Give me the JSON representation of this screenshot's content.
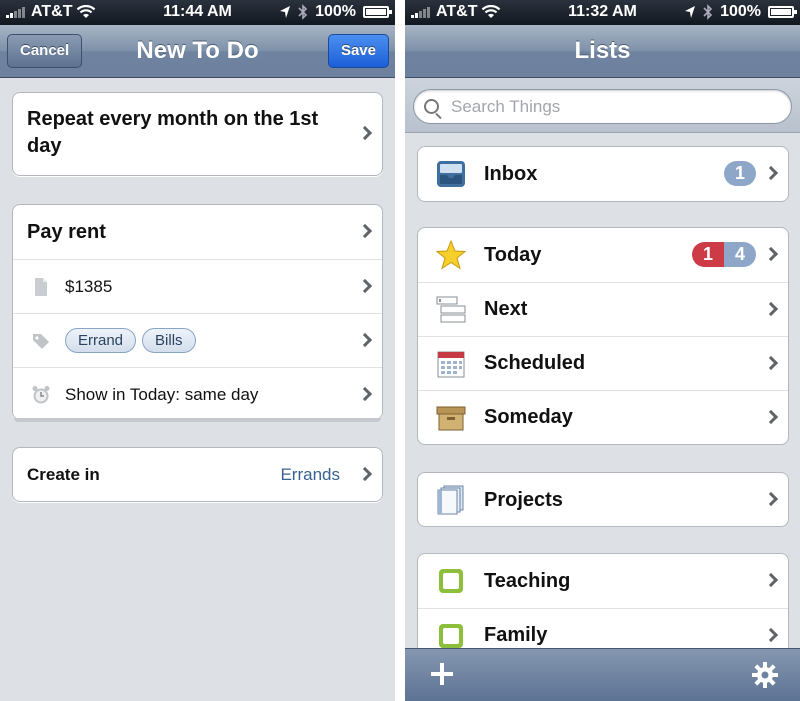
{
  "left": {
    "status": {
      "carrier": "AT&T",
      "time": "11:44 AM",
      "battery": "100%"
    },
    "nav": {
      "title": "New To Do",
      "cancel": "Cancel",
      "save": "Save"
    },
    "repeat_text": "Repeat every month on the 1st day",
    "todo": {
      "title": "Pay rent",
      "note": "$1385",
      "tags": [
        "Errand",
        "Bills"
      ],
      "reminder": "Show in Today: same day"
    },
    "create_in": {
      "label": "Create in",
      "value": "Errands"
    }
  },
  "right": {
    "status": {
      "carrier": "AT&T",
      "time": "11:32 AM",
      "battery": "100%"
    },
    "nav": {
      "title": "Lists"
    },
    "search": {
      "placeholder": "Search Things"
    },
    "lists": {
      "inbox": {
        "label": "Inbox",
        "count": "1"
      },
      "today": {
        "label": "Today",
        "due": "1",
        "count": "4"
      },
      "next": {
        "label": "Next"
      },
      "scheduled": {
        "label": "Scheduled"
      },
      "someday": {
        "label": "Someday"
      },
      "projects": {
        "label": "Projects"
      },
      "teaching": {
        "label": "Teaching"
      },
      "family": {
        "label": "Family"
      }
    }
  },
  "colors": {
    "accent": "#1b5fd8",
    "navbar": "#7e91a8",
    "badge_blue": "#8ea7c8",
    "badge_red": "#cc3b46",
    "tag_text": "#3a6290"
  }
}
